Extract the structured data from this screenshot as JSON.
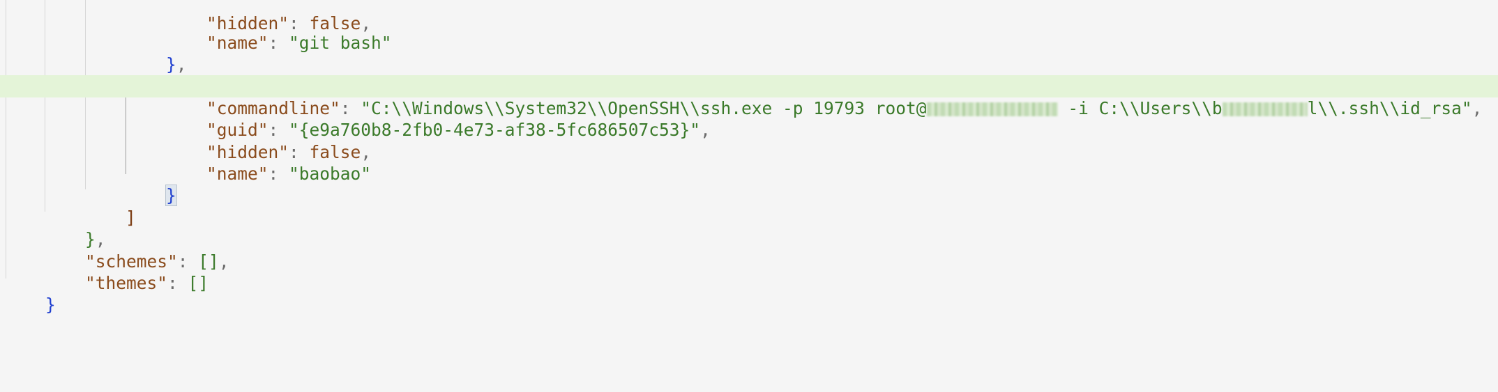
{
  "editor": {
    "lines": {
      "l0": {
        "key": "\"hidden\"",
        "value": "false"
      },
      "l1": {
        "key": "\"name\"",
        "value": "\"git bash\""
      },
      "l2": {
        "close": "}"
      },
      "l3": {
        "open": "{"
      },
      "l4": {
        "key": "\"commandline\"",
        "value_start": "\"C:\\\\Windows\\\\System32\\\\OpenSSH\\\\ssh.exe -p 19793 root@",
        "value_mid": " -i C:\\\\Users\\\\b",
        "value_end": "l\\\\.ssh\\\\id_rsa\""
      },
      "l5": {
        "key": "\"guid\"",
        "value": "\"{e9a760b8-2fb0-4e73-af38-5fc686507c53}\""
      },
      "l6": {
        "key": "\"hidden\"",
        "value": "false"
      },
      "l7": {
        "key": "\"name\"",
        "value": "\"baobao\""
      },
      "l8": {
        "close": "}"
      },
      "l9": {
        "close": "]"
      },
      "l10": {
        "close": "}"
      },
      "l11": {
        "key": "\"schemes\"",
        "value": "[]"
      },
      "l12": {
        "key": "\"themes\"",
        "value": "[]"
      },
      "l13": {
        "close": "}"
      }
    }
  },
  "colors": {
    "background": "#f5f5f5",
    "current_line": "#e4f4d8",
    "key": "#8a4b1c",
    "string": "#3b7a2a",
    "bracket_blue": "#1f3fcf"
  }
}
